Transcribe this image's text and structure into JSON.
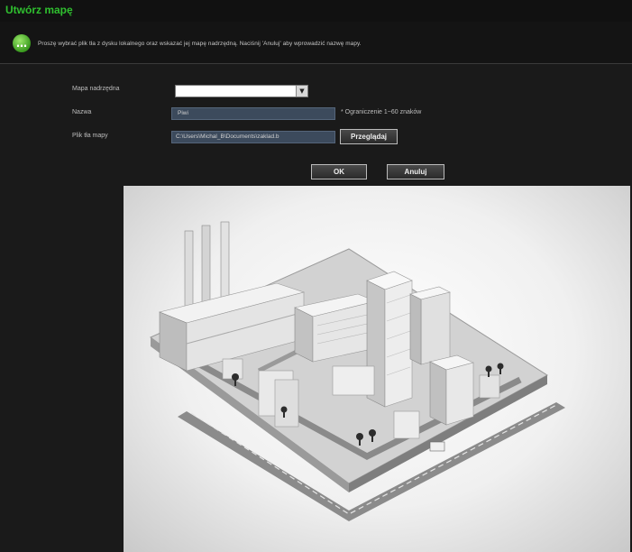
{
  "window": {
    "title": "Utwórz mapę"
  },
  "info": {
    "text": "Proszę wybrać plik tła z dysku lokalnego oraz wskazać jej mapę nadrzędną. Naciśnij 'Anuluj' aby wprowadzić nazwę mapy."
  },
  "form": {
    "parent_map_label": "Mapa nadrzędna",
    "parent_map_value": "",
    "name_label": "Nazwa",
    "name_value": "Piwi",
    "name_hint": "* Ograniczenie 1~60 znaków",
    "file_label": "Plik tła mapy",
    "file_value": "C:\\Users\\Michal_B\\Documents\\zaklad.b",
    "browse_button": "Przeglądaj"
  },
  "actions": {
    "ok": "OK",
    "cancel": "Anuluj"
  },
  "preview": {
    "description_icon": "factory-map-image"
  }
}
